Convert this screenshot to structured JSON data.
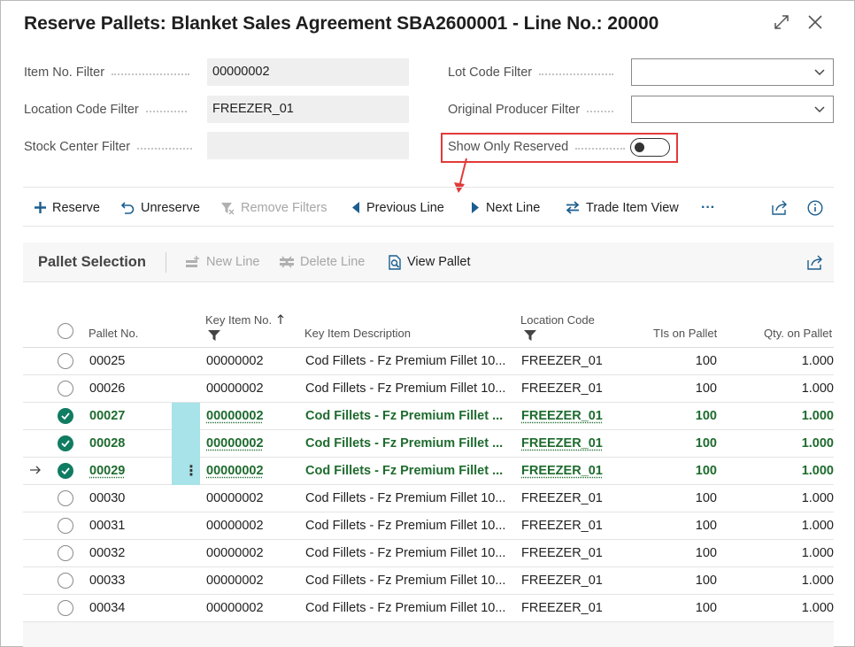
{
  "dialog": {
    "title": "Reserve Pallets: Blanket Sales Agreement SBA2600001 - Line No.: 20000"
  },
  "filters": {
    "item_no": {
      "label": "Item No. Filter",
      "value": "00000002"
    },
    "location_code": {
      "label": "Location Code Filter",
      "value": "FREEZER_01"
    },
    "stock_center": {
      "label": "Stock Center Filter",
      "value": ""
    },
    "lot_code": {
      "label": "Lot Code Filter",
      "value": ""
    },
    "original_producer": {
      "label": "Original Producer Filter",
      "value": ""
    },
    "show_only_reserved": {
      "label": "Show Only Reserved",
      "value": false
    }
  },
  "actions": {
    "reserve": "Reserve",
    "unreserve": "Unreserve",
    "remove_filters": "Remove Filters",
    "previous_line": "Previous Line",
    "next_line": "Next Line",
    "trade_item_view": "Trade Item View",
    "more": "···"
  },
  "part": {
    "title": "Pallet Selection",
    "new_line": "New Line",
    "delete_line": "Delete Line",
    "view_pallet": "View Pallet"
  },
  "columns": {
    "pallet_no": "Pallet No.",
    "key_item_no": "Key Item No.",
    "key_item_description": "Key Item Description",
    "location_code": "Location Code",
    "tis_on_pallet": "TIs on Pallet",
    "qty_on_pallet": "Qty. on Pallet"
  },
  "rows": [
    {
      "pallet_no": "00025",
      "key_item_no": "00000002",
      "description": "Cod Fillets - Fz Premium Fillet 10...",
      "location": "FREEZER_01",
      "tis": "100",
      "qty": "1.000",
      "selected": false
    },
    {
      "pallet_no": "00026",
      "key_item_no": "00000002",
      "description": "Cod Fillets - Fz Premium Fillet 10...",
      "location": "FREEZER_01",
      "tis": "100",
      "qty": "1.000",
      "selected": false
    },
    {
      "pallet_no": "00027",
      "key_item_no": "00000002",
      "description": "Cod Fillets - Fz Premium Fillet ...",
      "location": "FREEZER_01",
      "tis": "100",
      "qty": "1.000",
      "selected": true
    },
    {
      "pallet_no": "00028",
      "key_item_no": "00000002",
      "description": "Cod Fillets - Fz Premium Fillet ...",
      "location": "FREEZER_01",
      "tis": "100",
      "qty": "1.000",
      "selected": true
    },
    {
      "pallet_no": "00029",
      "key_item_no": "00000002",
      "description": "Cod Fillets - Fz Premium Fillet ...",
      "location": "FREEZER_01",
      "tis": "100",
      "qty": "1.000",
      "selected": true
    },
    {
      "pallet_no": "00030",
      "key_item_no": "00000002",
      "description": "Cod Fillets - Fz Premium Fillet 10...",
      "location": "FREEZER_01",
      "tis": "100",
      "qty": "1.000",
      "selected": false
    },
    {
      "pallet_no": "00031",
      "key_item_no": "00000002",
      "description": "Cod Fillets - Fz Premium Fillet 10...",
      "location": "FREEZER_01",
      "tis": "100",
      "qty": "1.000",
      "selected": false
    },
    {
      "pallet_no": "00032",
      "key_item_no": "00000002",
      "description": "Cod Fillets - Fz Premium Fillet 10...",
      "location": "FREEZER_01",
      "tis": "100",
      "qty": "1.000",
      "selected": false
    },
    {
      "pallet_no": "00033",
      "key_item_no": "00000002",
      "description": "Cod Fillets - Fz Premium Fillet 10...",
      "location": "FREEZER_01",
      "tis": "100",
      "qty": "1.000",
      "selected": false
    },
    {
      "pallet_no": "00034",
      "key_item_no": "00000002",
      "description": "Cod Fillets - Fz Premium Fillet 10...",
      "location": "FREEZER_01",
      "tis": "100",
      "qty": "1.000",
      "selected": false
    }
  ],
  "colors": {
    "accent": "#107c62",
    "selected_text": "#1e6b2e",
    "highlight": "#e23a3a",
    "active_cell": "#a7e3e8"
  }
}
